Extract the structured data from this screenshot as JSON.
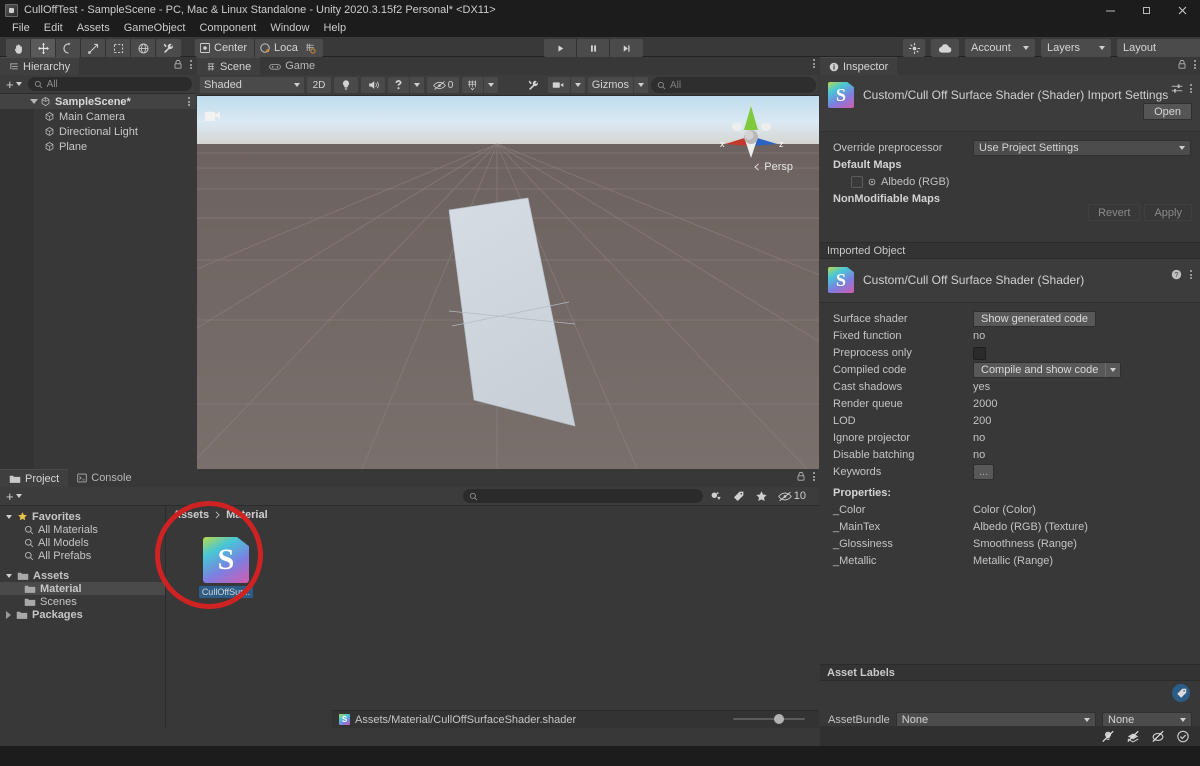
{
  "window": {
    "title": "CullOffTest - SampleScene - PC, Mac & Linux Standalone - Unity 2020.3.15f2 Personal* <DX11>",
    "minimize": "minimize-icon",
    "maximize": "maximize-icon",
    "close": "close-icon"
  },
  "menu": {
    "items": [
      "File",
      "Edit",
      "Assets",
      "GameObject",
      "Component",
      "Window",
      "Help"
    ]
  },
  "toolbar": {
    "tools": [
      "hand-tool",
      "move-tool",
      "rotate-tool",
      "scale-tool",
      "rect-tool",
      "transform-tool",
      "custom-tool"
    ],
    "pivot_mode": "Center",
    "pivot_space": "Local",
    "snap": "grid-snap-icon",
    "play": "play-icon",
    "pause": "pause-icon",
    "step": "step-icon",
    "collab_cloud": "cloud-icon",
    "services": "services-icon",
    "account": "Account",
    "layers": "Layers",
    "layout": "Layout"
  },
  "hierarchy": {
    "tab": "Hierarchy",
    "tab_icon": "hierarchy-icon",
    "lock_icon": "lock-icon",
    "menu_icon": "kebab-icon",
    "create_label": "+",
    "search_placeholder": "All",
    "search_value": "",
    "scene": "SampleScene*",
    "objects": [
      "Main Camera",
      "Directional Light",
      "Plane"
    ]
  },
  "scene_view": {
    "tabs": [
      {
        "label": "Scene",
        "icon": "scene-icon",
        "active": true
      },
      {
        "label": "Game",
        "icon": "game-icon",
        "active": false
      }
    ],
    "draw_mode": "Shaded",
    "mode_2d": "2D",
    "lighting_icon": "lighting-icon",
    "audio_icon": "audio-icon",
    "fx_icon": "effects-icon",
    "hidden_count": "0",
    "hidden_icon": "hidden-objects-icon",
    "grid_icon": "grid-visibility-icon",
    "tools_icon": "scene-tools-icon",
    "camera_icon": "scene-camera-icon",
    "gizmos": "Gizmos",
    "search_placeholder": "All",
    "search_value": "",
    "gizmo_axes": {
      "x": "x",
      "y": "y",
      "z": "z"
    },
    "projection": "Persp",
    "menu_icon": "kebab-icon"
  },
  "project": {
    "tabs": [
      {
        "label": "Project",
        "icon": "project-icon",
        "active": true
      },
      {
        "label": "Console",
        "icon": "console-icon",
        "active": false
      }
    ],
    "lock_icon": "lock-icon",
    "menu_icon": "kebab-icon",
    "create_label": "+",
    "search_placeholder": "",
    "search_value": "",
    "filter_type_icon": "filter-by-type-icon",
    "filter_label_icon": "filter-by-label-icon",
    "favorite_icon": "star-icon",
    "hidden_packages_icon": "hidden-packages-icon",
    "hidden_packages_count": "10",
    "tree": [
      {
        "label": "Favorites",
        "icon": "star-icon",
        "depth": 0,
        "expanded": true,
        "bold": true
      },
      {
        "label": "All Materials",
        "icon": "search-icon",
        "depth": 1
      },
      {
        "label": "All Models",
        "icon": "search-icon",
        "depth": 1
      },
      {
        "label": "All Prefabs",
        "icon": "search-icon",
        "depth": 1
      },
      {
        "label": "Assets",
        "icon": "folder-open-icon",
        "depth": 0,
        "expanded": true,
        "bold": true
      },
      {
        "label": "Material",
        "icon": "folder-icon",
        "depth": 1,
        "selected": true
      },
      {
        "label": "Scenes",
        "icon": "folder-icon",
        "depth": 1
      },
      {
        "label": "Packages",
        "icon": "folder-icon",
        "depth": 0,
        "collapsed": true,
        "bold": true
      }
    ],
    "breadcrumb": [
      "Assets",
      "Material"
    ],
    "assets": [
      {
        "label": "CullOffSur...",
        "icon": "shader-file-icon",
        "letter": "S",
        "selected": true
      }
    ],
    "status_path": "Assets/Material/CullOffSurfaceShader.shader",
    "status_icon": "shader-file-icon",
    "zoom_value": "57"
  },
  "inspector": {
    "tab": "Inspector",
    "tab_icon": "info-icon",
    "lock_icon": "lock-icon",
    "menu_icon": "kebab-icon",
    "import_title": "Custom/Cull Off Surface Shader (Shader) Import Settings",
    "preset_icon": "preset-icon",
    "header_menu_icon": "kebab-icon",
    "open_button": "Open",
    "import_rows": [
      {
        "label": "Override preprocessor",
        "value": "Use Project Settings",
        "type": "dropdown"
      }
    ],
    "default_maps_label": "Default Maps",
    "albedo_label": "Albedo (RGB)",
    "nonmodifiable_label": "NonModifiable Maps",
    "revert_button": "Revert",
    "apply_button": "Apply",
    "imported_object_header": "Imported Object",
    "object_title": "Custom/Cull Off Surface Shader (Shader)",
    "help_icon": "help-icon",
    "object_menu_icon": "kebab-icon",
    "shader_rows": [
      {
        "label": "Surface shader",
        "value": "Show generated code",
        "type": "button"
      },
      {
        "label": "Fixed function",
        "value": "no",
        "type": "text"
      },
      {
        "label": "Preprocess only",
        "value": "",
        "type": "checkbox"
      },
      {
        "label": "Compiled code",
        "value": "Compile and show code",
        "type": "split-button"
      },
      {
        "label": "Cast shadows",
        "value": "yes",
        "type": "text"
      },
      {
        "label": "Render queue",
        "value": "2000",
        "type": "text"
      },
      {
        "label": "LOD",
        "value": "200",
        "type": "text"
      },
      {
        "label": "Ignore projector",
        "value": "no",
        "type": "text"
      },
      {
        "label": "Disable batching",
        "value": "no",
        "type": "text"
      },
      {
        "label": "Keywords",
        "value": "...",
        "type": "button-sm"
      }
    ],
    "properties_label": "Properties:",
    "properties": [
      {
        "name": "_Color",
        "value": "Color (Color)"
      },
      {
        "name": "_MainTex",
        "value": "Albedo (RGB) (Texture)"
      },
      {
        "name": "_Glossiness",
        "value": "Smoothness (Range)"
      },
      {
        "name": "_Metallic",
        "value": "Metallic (Range)"
      }
    ],
    "asset_labels_header": "Asset Labels",
    "label_tag_icon": "label-tag-icon",
    "assetbundle_label": "AssetBundle",
    "assetbundle_value": "None",
    "assetvariant_value": "None",
    "bottom_icons": [
      "no-lighting-icon",
      "no-fog-icon",
      "no-shadows-icon",
      "check-icon"
    ]
  },
  "colors": {
    "accent_blue": "#2c5d87",
    "annotation_red": "#cf2222",
    "panel_bg": "#383838",
    "toolbar_bg": "#3c3c3c",
    "chrome_bg": "#1c1c1c"
  }
}
